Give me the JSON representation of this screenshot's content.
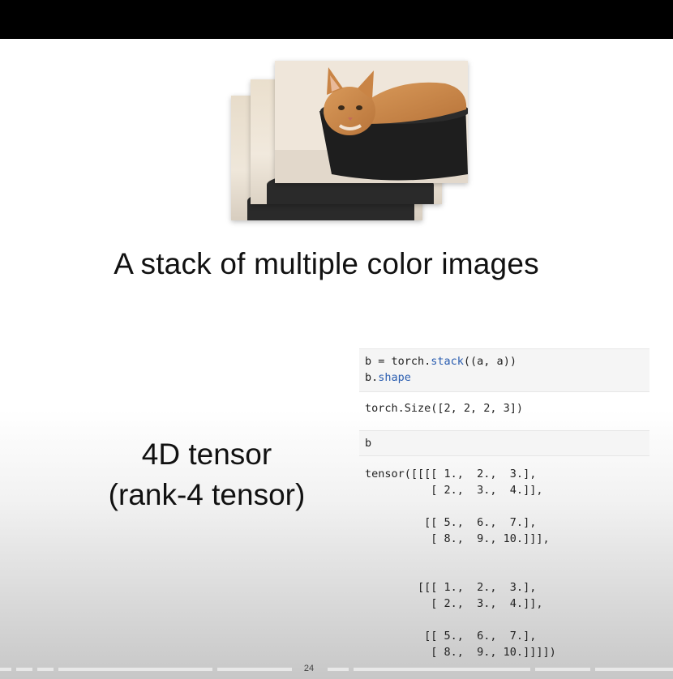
{
  "slide": {
    "title": "A stack of multiple color images",
    "label_line1": "4D tensor",
    "label_line2": "(rank-4 tensor)",
    "page_number": "24"
  },
  "images": {
    "description_icon": "cat-in-pot-photo",
    "count": 3
  },
  "code": {
    "cell1_line1_pre": "b = torch.",
    "cell1_line1_attr": "stack",
    "cell1_line1_post": "((a, a))",
    "cell1_line2_pre": "b.",
    "cell1_line2_attr": "shape",
    "output1": "torch.Size([2, 2, 2, 3])",
    "cell2": "b",
    "output2": "tensor([[[[ 1.,  2.,  3.],\n          [ 2.,  3.,  4.]],\n\n         [[ 5.,  6.,  7.],\n          [ 8.,  9., 10.]]],\n\n\n        [[[ 1.,  2.,  3.],\n          [ 2.,  3.,  4.]],\n\n         [[ 5.,  6.,  7.],\n          [ 8.,  9., 10.]]]])"
  },
  "colors": {
    "top_bar": "#000000",
    "code_attr": "#2a5db0"
  }
}
